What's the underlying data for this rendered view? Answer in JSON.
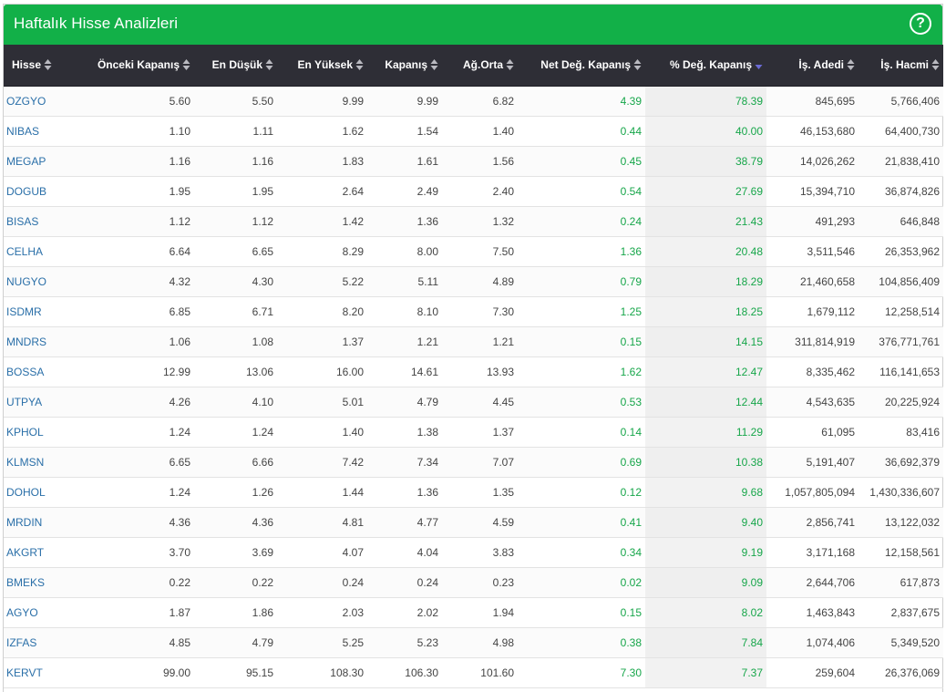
{
  "header": {
    "title": "Haftalık Hisse Analizleri",
    "help_label": "?"
  },
  "columns": [
    "Hisse",
    "Önceki Kapanış",
    "En Düşük",
    "En Yüksek",
    "Kapanış",
    "Ağ.Orta",
    "Net Değ. Kapanış",
    "% Değ. Kapanış",
    "İş. Adedi",
    "İş. Hacmi"
  ],
  "sorted_column": "% Değ. Kapanış",
  "sort_direction": "desc",
  "colors": {
    "header_green": "#12b048",
    "table_header": "#2e2e36",
    "positive": "#17a64a",
    "link": "#2a6fa8",
    "sort_active": "#6b6bd6"
  },
  "rows": [
    [
      "OZGYO",
      "5.60",
      "5.50",
      "9.99",
      "9.99",
      "6.82",
      "4.39",
      "78.39",
      "845,695",
      "5,766,406"
    ],
    [
      "NIBAS",
      "1.10",
      "1.11",
      "1.62",
      "1.54",
      "1.40",
      "0.44",
      "40.00",
      "46,153,680",
      "64,400,730"
    ],
    [
      "MEGAP",
      "1.16",
      "1.16",
      "1.83",
      "1.61",
      "1.56",
      "0.45",
      "38.79",
      "14,026,262",
      "21,838,410"
    ],
    [
      "DOGUB",
      "1.95",
      "1.95",
      "2.64",
      "2.49",
      "2.40",
      "0.54",
      "27.69",
      "15,394,710",
      "36,874,826"
    ],
    [
      "BISAS",
      "1.12",
      "1.12",
      "1.42",
      "1.36",
      "1.32",
      "0.24",
      "21.43",
      "491,293",
      "646,848"
    ],
    [
      "CELHA",
      "6.64",
      "6.65",
      "8.29",
      "8.00",
      "7.50",
      "1.36",
      "20.48",
      "3,511,546",
      "26,353,962"
    ],
    [
      "NUGYO",
      "4.32",
      "4.30",
      "5.22",
      "5.11",
      "4.89",
      "0.79",
      "18.29",
      "21,460,658",
      "104,856,409"
    ],
    [
      "ISDMR",
      "6.85",
      "6.71",
      "8.20",
      "8.10",
      "7.30",
      "1.25",
      "18.25",
      "1,679,112",
      "12,258,514"
    ],
    [
      "MNDRS",
      "1.06",
      "1.08",
      "1.37",
      "1.21",
      "1.21",
      "0.15",
      "14.15",
      "311,814,919",
      "376,771,761"
    ],
    [
      "BOSSA",
      "12.99",
      "13.06",
      "16.00",
      "14.61",
      "13.93",
      "1.62",
      "12.47",
      "8,335,462",
      "116,141,653"
    ],
    [
      "UTPYA",
      "4.26",
      "4.10",
      "5.01",
      "4.79",
      "4.45",
      "0.53",
      "12.44",
      "4,543,635",
      "20,225,924"
    ],
    [
      "KPHOL",
      "1.24",
      "1.24",
      "1.40",
      "1.38",
      "1.37",
      "0.14",
      "11.29",
      "61,095",
      "83,416"
    ],
    [
      "KLMSN",
      "6.65",
      "6.66",
      "7.42",
      "7.34",
      "7.07",
      "0.69",
      "10.38",
      "5,191,407",
      "36,692,379"
    ],
    [
      "DOHOL",
      "1.24",
      "1.26",
      "1.44",
      "1.36",
      "1.35",
      "0.12",
      "9.68",
      "1,057,805,094",
      "1,430,336,607"
    ],
    [
      "MRDIN",
      "4.36",
      "4.36",
      "4.81",
      "4.77",
      "4.59",
      "0.41",
      "9.40",
      "2,856,741",
      "13,122,032"
    ],
    [
      "AKGRT",
      "3.70",
      "3.69",
      "4.07",
      "4.04",
      "3.83",
      "0.34",
      "9.19",
      "3,171,168",
      "12,158,561"
    ],
    [
      "BMEKS",
      "0.22",
      "0.22",
      "0.24",
      "0.24",
      "0.23",
      "0.02",
      "9.09",
      "2,644,706",
      "617,873"
    ],
    [
      "AGYO",
      "1.87",
      "1.86",
      "2.03",
      "2.02",
      "1.94",
      "0.15",
      "8.02",
      "1,463,843",
      "2,837,675"
    ],
    [
      "IZFAS",
      "4.85",
      "4.79",
      "5.25",
      "5.23",
      "4.98",
      "0.38",
      "7.84",
      "1,074,406",
      "5,349,520"
    ],
    [
      "KERVT",
      "99.00",
      "95.15",
      "108.30",
      "106.30",
      "101.60",
      "7.30",
      "7.37",
      "259,604",
      "26,376,069"
    ]
  ]
}
